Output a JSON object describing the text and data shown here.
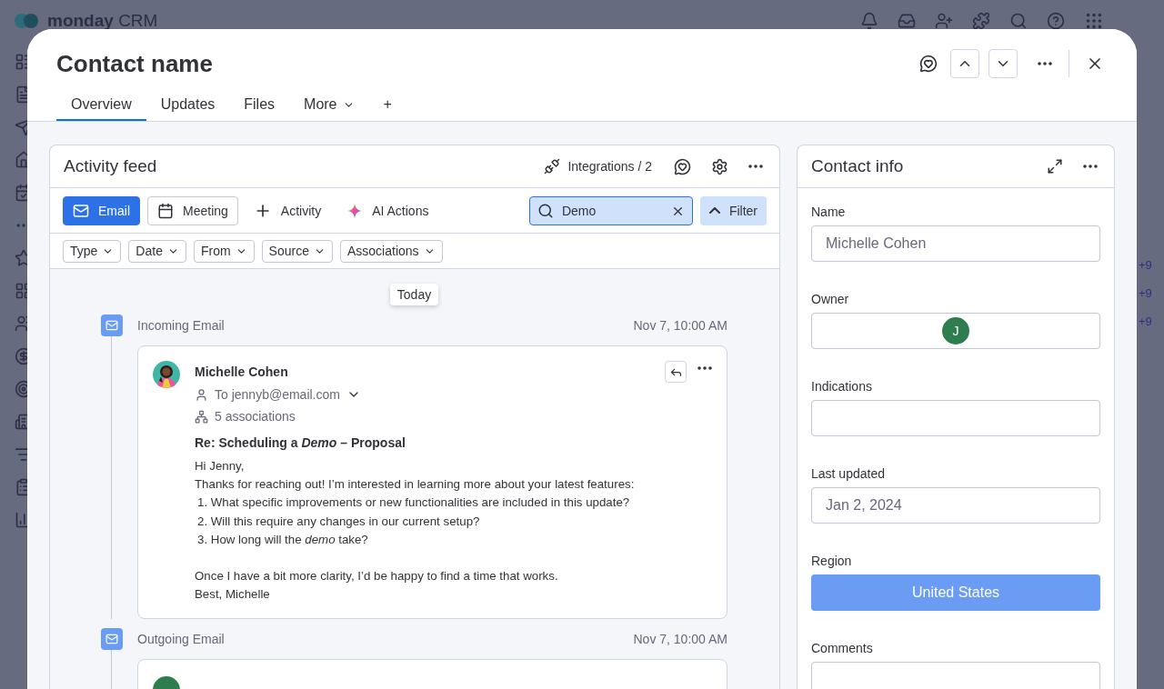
{
  "app": {
    "logo_bold": "monday",
    "logo_light": "CRM",
    "side_values": [
      "+9",
      "+9",
      "+9"
    ]
  },
  "modal": {
    "title": "Contact name",
    "add_tab": "+",
    "tabs": [
      {
        "label": "Overview",
        "selected": true,
        "kind": "plain"
      },
      {
        "label": "Updates",
        "selected": false,
        "kind": "plain"
      },
      {
        "label": "Files",
        "selected": false,
        "kind": "plain"
      },
      {
        "label": "More",
        "selected": false,
        "kind": "menu"
      }
    ]
  },
  "activity_feed": {
    "title": "Activity feed",
    "integrations": "Integrations / 2",
    "actions": [
      {
        "label": "Email",
        "kind": "primary"
      },
      {
        "label": "Meeting",
        "kind": "outlined"
      },
      {
        "label": "Activity",
        "kind": "plain"
      },
      {
        "label": "AI Actions",
        "kind": "ai"
      }
    ],
    "search": {
      "value": "Demo"
    },
    "filter": "Filter",
    "filters": [
      "Type",
      "Date",
      "From",
      "Source",
      "Associations"
    ],
    "date_marker": "Today",
    "items": [
      {
        "type": "Incoming Email",
        "time": "Nov 7, 10:00 AM",
        "kind": "full",
        "sender": "Michelle Cohen",
        "to": "To jennyb@email.com",
        "associations": "5 associations",
        "subject": "Re: Scheduling a *Demo* – Proposal",
        "opening": [
          "Hi Jenny,",
          "Thanks for reaching out! I’m interested in learning more about your latest features:"
        ],
        "questions": [
          "1. What specific improvements or new functionalities are included in this update?",
          "2. Will this require any changes in our current setup?",
          "3. How long will the *demo* take?"
        ],
        "closing": [
          "Once I have a bit more clarity, I’d be happy to find a time that works.",
          "Best, Michelle"
        ]
      },
      {
        "type": "Outgoing Email",
        "time": "Nov 7, 10:00 AM",
        "kind": "cut"
      }
    ]
  },
  "contact_info": {
    "title": "Contact info",
    "fields": [
      {
        "label": "Name",
        "kind": "text",
        "value": "Michelle Cohen"
      },
      {
        "label": "Owner",
        "kind": "person",
        "initial": "J"
      },
      {
        "label": "Indications",
        "kind": "text"
      },
      {
        "label": "Last updated",
        "kind": "text",
        "value": "Jan 2, 2024"
      },
      {
        "label": "Region",
        "kind": "status",
        "value": "United States"
      },
      {
        "label": "Comments",
        "kind": "text"
      }
    ]
  }
}
